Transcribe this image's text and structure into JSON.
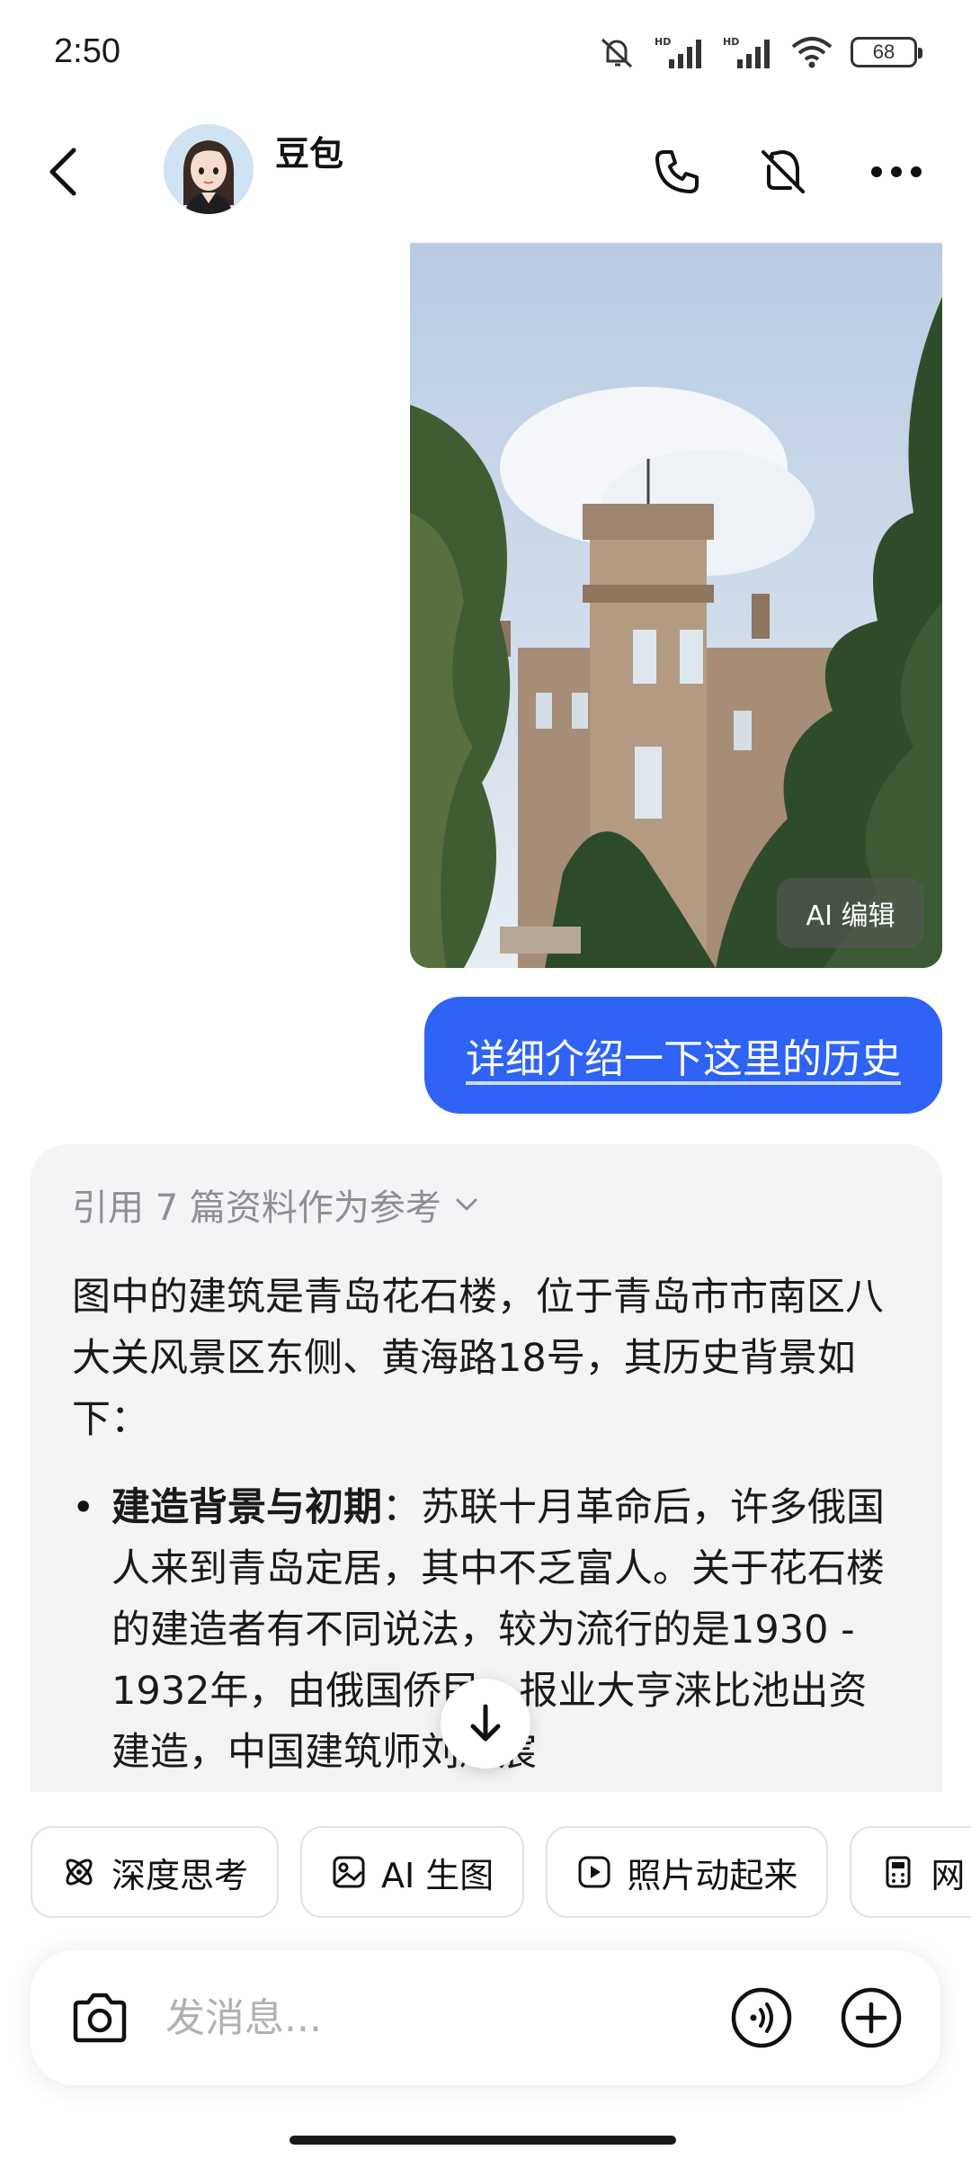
{
  "status_bar": {
    "time": "2:50",
    "battery": "68",
    "icons": [
      "mute-icon",
      "hd-signal-icon",
      "hd-signal-icon",
      "wifi-icon",
      "battery-icon"
    ]
  },
  "header": {
    "title": "豆包",
    "icons": [
      "back-icon",
      "phone-icon",
      "speaker-mute-icon",
      "more-icon"
    ]
  },
  "image_card": {
    "edit_label": "AI 编辑"
  },
  "user_message": "详细介绍一下这里的历史",
  "reply": {
    "reference_label": "引用 7 篇资料作为参考",
    "paragraph": "图中的建筑是青岛花石楼，位于青岛市市南区八大关风景区东侧、黄海路18号，其历史背景如下：",
    "bullet_title": "建造背景与初期",
    "bullet_text": "：苏联十月革命后，许多俄国人来到青岛定居，其中不乏富人。关于花石楼的建造者有不同说法，较为流行的是1930 - 1932年，由俄国侨民、报业大亨涞比池出资建造，中国建筑师刘耀宸"
  },
  "quick_actions": [
    {
      "label": "深度思考",
      "icon": "atom-icon"
    },
    {
      "label": "AI 生图",
      "icon": "image-icon"
    },
    {
      "label": "照片动起来",
      "icon": "play-icon"
    },
    {
      "label": "网",
      "icon": "calculator-icon"
    }
  ],
  "composer": {
    "placeholder": "发消息..."
  },
  "colors": {
    "accent": "#2e63f5",
    "card_bg": "#f4f4f6",
    "muted_text": "#8e8e93"
  }
}
